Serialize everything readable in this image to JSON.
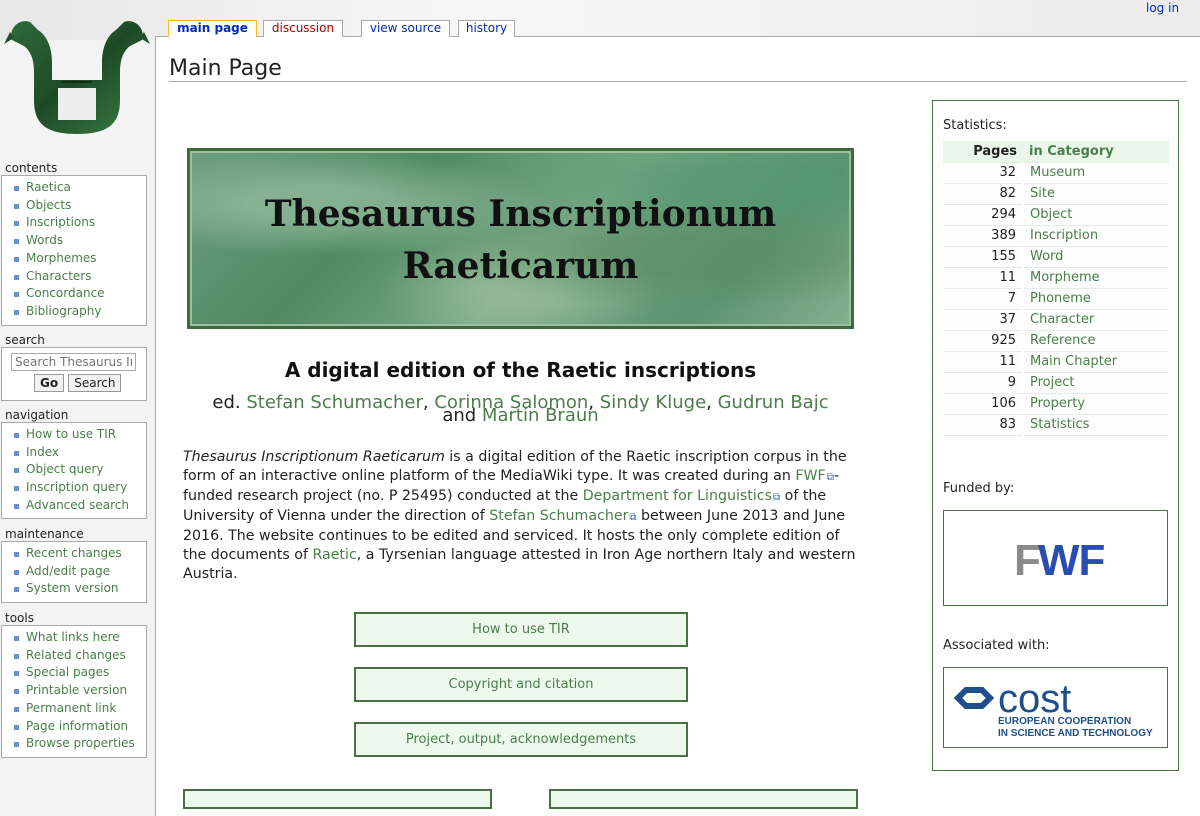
{
  "tabs": {
    "main_page": "main page",
    "discussion": "discussion",
    "view_source": "view source",
    "history": "history"
  },
  "login": "log in",
  "sidebar": {
    "contents": {
      "title": "contents",
      "items": [
        "Raetica",
        "Objects",
        "Inscriptions",
        "Words",
        "Morphemes",
        "Characters",
        "Concordance",
        "Bibliography"
      ]
    },
    "search": {
      "title": "search",
      "placeholder": "Search Thesaurus Inscriptionum Raeticarum",
      "go": "Go",
      "search": "Search"
    },
    "navigation": {
      "title": "navigation",
      "items": [
        "How to use TIR",
        "Index",
        "Object query",
        "Inscription query",
        "Advanced search"
      ]
    },
    "maintenance": {
      "title": "maintenance",
      "items": [
        "Recent changes",
        "Add/edit page",
        "System version"
      ]
    },
    "tools": {
      "title": "tools",
      "items": [
        "What links here",
        "Related changes",
        "Special pages",
        "Printable version",
        "Permanent link",
        "Page information",
        "Browse properties"
      ]
    }
  },
  "page": {
    "heading": "Main Page",
    "banner_line1": "Thesaurus Inscriptionum",
    "banner_line2": "Raeticarum",
    "subtitle": "A digital edition of the Raetic inscriptions",
    "editors": {
      "prefix": "ed.",
      "names": [
        "Stefan Schumacher",
        "Corinna Salomon",
        "Sindy Kluge",
        "Gudrun Bajc"
      ],
      "and": "and",
      "last": "Martin Braun"
    },
    "intro": {
      "title_italic": "Thesaurus Inscriptionum Raeticarum",
      "t1": " is a digital edition of the Raetic inscription corpus in the form of an interactive online platform of the MediaWiki type. It was created during an ",
      "fwf": "FWF",
      "t2": "-funded research project (no. P 25495) conducted at the ",
      "dept": "Department for Linguistics",
      "t3": " of the University of Vienna under the direction of ",
      "director": "Stefan Schumacher",
      "t4": " between June 2013 and June 2016. The website continues to be edited and serviced. It hosts the only complete edition of the documents of ",
      "raetic": "Raetic",
      "t5": ", a Tyrsenian language attested in Iron Age northern Italy and western Austria."
    },
    "buttons": [
      "How to use TIR",
      "Copyright and citation",
      "Project, output, acknowledgements"
    ]
  },
  "stats": {
    "label": "Statistics:",
    "header_pages": "Pages",
    "header_cat": "in Category",
    "rows": [
      {
        "n": "32",
        "cat": "Museum"
      },
      {
        "n": "82",
        "cat": "Site"
      },
      {
        "n": "294",
        "cat": "Object"
      },
      {
        "n": "389",
        "cat": "Inscription"
      },
      {
        "n": "155",
        "cat": "Word"
      },
      {
        "n": "11",
        "cat": "Morpheme"
      },
      {
        "n": "7",
        "cat": "Phoneme"
      },
      {
        "n": "37",
        "cat": "Character"
      },
      {
        "n": "925",
        "cat": "Reference"
      },
      {
        "n": "11",
        "cat": "Main Chapter"
      },
      {
        "n": "9",
        "cat": "Project"
      },
      {
        "n": "106",
        "cat": "Property"
      },
      {
        "n": "83",
        "cat": "Statistics"
      }
    ]
  },
  "funded": {
    "label": "Funded by:",
    "logo_text": "FWF"
  },
  "associated": {
    "label": "Associated with:",
    "logo_word": "cost",
    "logo_line1": "EUROPEAN COOPERATION",
    "logo_line2": "IN SCIENCE AND TECHNOLOGY"
  },
  "colors": {
    "link": "#4b7e4b",
    "box_border": "#4a6e46",
    "box_bg": "#eef9ee",
    "fwf_blue": "#2a4db0",
    "cost_blue": "#1f4f8a"
  }
}
